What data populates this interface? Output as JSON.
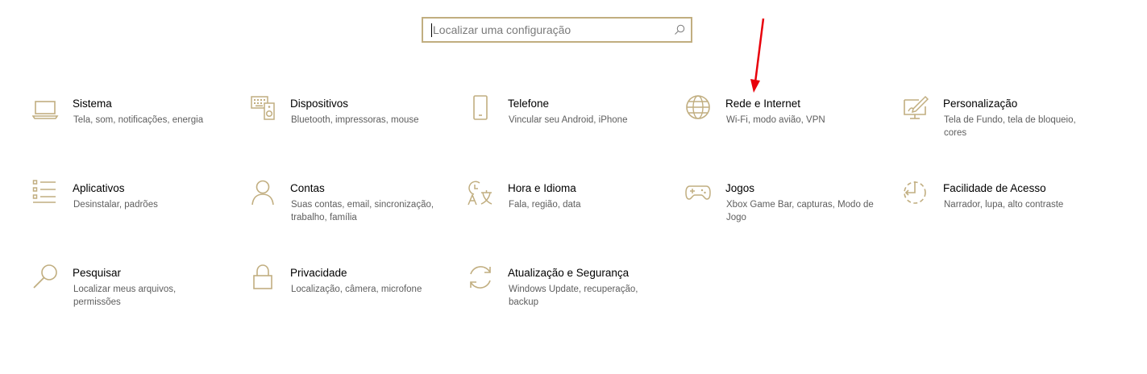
{
  "search": {
    "placeholder": "Localizar uma configuração"
  },
  "accent_color": "#c1ae80",
  "annotation_arrow_color": "#e8000b",
  "tiles": [
    {
      "title": "Sistema",
      "desc": "Tela, som, notificações, energia",
      "icon": "laptop-icon"
    },
    {
      "title": "Dispositivos",
      "desc": "Bluetooth, impressoras, mouse",
      "icon": "keyboard-speaker-icon"
    },
    {
      "title": "Telefone",
      "desc": "Vincular seu Android, iPhone",
      "icon": "phone-icon"
    },
    {
      "title": "Rede e Internet",
      "desc": "Wi-Fi, modo avião, VPN",
      "icon": "globe-icon"
    },
    {
      "title": "Personalização",
      "desc": "Tela de Fundo, tela de bloqueio, cores",
      "icon": "paint-monitor-icon"
    },
    {
      "title": "Aplicativos",
      "desc": "Desinstalar, padrões",
      "icon": "apps-list-icon"
    },
    {
      "title": "Contas",
      "desc": "Suas contas, email, sincronização, trabalho, família",
      "icon": "person-icon"
    },
    {
      "title": "Hora e Idioma",
      "desc": "Fala, região, data",
      "icon": "time-language-icon"
    },
    {
      "title": "Jogos",
      "desc": "Xbox Game Bar, capturas, Modo de Jogo",
      "icon": "gamepad-icon"
    },
    {
      "title": "Facilidade de Acesso",
      "desc": "Narrador, lupa, alto contraste",
      "icon": "ease-of-access-icon"
    },
    {
      "title": "Pesquisar",
      "desc": "Localizar meus arquivos, permissões",
      "icon": "magnifier-icon"
    },
    {
      "title": "Privacidade",
      "desc": "Localização, câmera, microfone",
      "icon": "lock-icon"
    },
    {
      "title": "Atualização e Segurança",
      "desc": "Windows Update, recuperação, backup",
      "icon": "update-sync-icon"
    }
  ]
}
